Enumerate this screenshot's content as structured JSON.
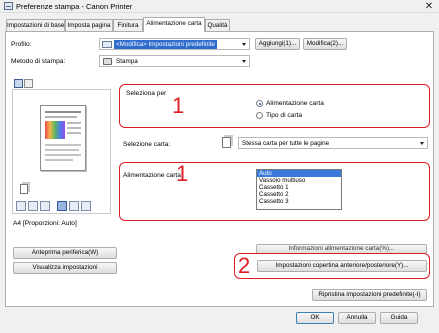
{
  "window": {
    "title": "Preferenze stampa - Canon Printer",
    "close_glyph": "✕"
  },
  "tabs": [
    {
      "label": "Impostazioni di base"
    },
    {
      "label": "Imposta pagina"
    },
    {
      "label": "Finitura"
    },
    {
      "label": "Alimentazione carta",
      "active": true
    },
    {
      "label": "Qualità"
    }
  ],
  "profile": {
    "label": "Profilo:",
    "value": "<Modifica> Impostazioni predefinite",
    "add_button": "Aggiungi(1)...",
    "edit_button": "Modifica(2)..."
  },
  "output_method": {
    "label": "Metodo di stampa:",
    "value": "Stampa"
  },
  "select_by": {
    "label": "Seleziona per",
    "options": [
      {
        "label": "Alimentazione carta",
        "selected": true
      },
      {
        "label": "Tipo di carta",
        "selected": false
      }
    ]
  },
  "paper_selection": {
    "label": "Selezione carta:",
    "value": "Stessa carta per tutte le pagine"
  },
  "paper_source": {
    "label": "Alimentazione carta:",
    "items": [
      "Auto",
      "Vassoio multiuso",
      "Cassetto 1",
      "Cassetto 2",
      "Cassetto 3"
    ],
    "selected_index": 0
  },
  "preview": {
    "caption": "A4 [Proporzioni: Auto]"
  },
  "left_buttons": {
    "page_view": "Anteprima periferica(W)",
    "view_settings": "Visualizza impostazioni"
  },
  "right_buttons": {
    "paper_source_info": "Informazioni alimentazione carta(%)...",
    "front_back_cover": "Impostazioni copertina anteriore/posteriore(Y)...",
    "restore_defaults": "Ripristina impostazioni predefinite(-I)"
  },
  "dialog_buttons": {
    "ok": "OK",
    "cancel": "Annulla",
    "help": "Guida"
  },
  "callouts": {
    "one_a": "1",
    "one_b": "1",
    "two": "2"
  },
  "colors": {
    "callout_red": "#e01c24",
    "selection_blue": "#3879d9",
    "profile_blue": "#2e6ccd"
  },
  "icons": [
    "printer-icon",
    "document-icon",
    "radio-button",
    "dropdown-caret-icon"
  ]
}
